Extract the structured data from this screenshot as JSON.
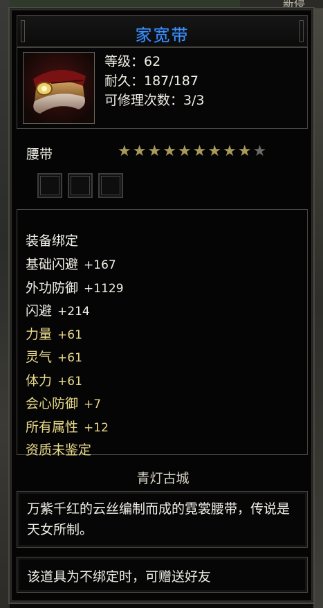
{
  "background": {
    "top_right_text": "新侵"
  },
  "item": {
    "name": "家宽带",
    "name_color": "#3f8ff2",
    "icon": "belt-icon",
    "level_label": "等级：62",
    "durability_label": "耐久：187/187",
    "repair_label": "可修理次数：3/3",
    "type": "腰带",
    "stars_filled": 9,
    "stars_total": 10,
    "gem_slots": 3
  },
  "stats": {
    "bind": {
      "text": "装备绑定",
      "color": "#f2f0e8"
    },
    "lines": [
      {
        "label": "基础闪避",
        "value": "+167",
        "label_color": "#f0eee6",
        "value_color": "#f0eee6"
      },
      {
        "label": "外功防御",
        "value": "+1129",
        "label_color": "#f0eee6",
        "value_color": "#f0eee6"
      },
      {
        "label": "闪避",
        "value": "+214",
        "label_color": "#f0eee6",
        "value_color": "#f0eee6"
      },
      {
        "label": "力量",
        "value": "+61",
        "label_color": "#e8d98a",
        "value_color": "#e8d98a"
      },
      {
        "label": "灵气",
        "value": "+61",
        "label_color": "#e8d98a",
        "value_color": "#e8d98a"
      },
      {
        "label": "体力",
        "value": "+61",
        "label_color": "#e8d98a",
        "value_color": "#e8d98a"
      },
      {
        "label": "会心防御",
        "value": "+7",
        "label_color": "#e8d98a",
        "value_color": "#e8d98a"
      },
      {
        "label": "所有属性",
        "value": "+12",
        "label_color": "#e8d98a",
        "value_color": "#e8d98a"
      }
    ],
    "quality": {
      "text": "资质未鉴定",
      "color": "#e8d98a"
    }
  },
  "region": "青灯古城",
  "description": "万紫千红的云丝编制而成的霓裳腰带，传说是天女所制。",
  "trade_note": "该道具为不绑定时，可赠送好友"
}
